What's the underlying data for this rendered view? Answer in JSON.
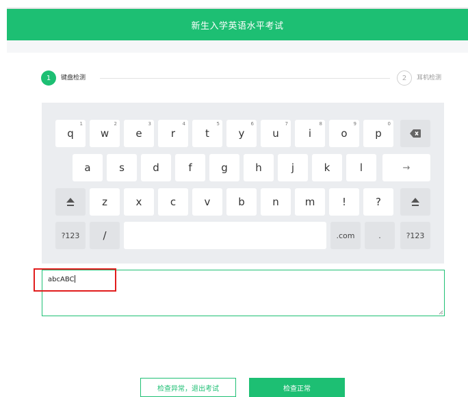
{
  "header": {
    "title": "新生入学英语水平考试"
  },
  "steps": [
    {
      "number": "1",
      "label": "键盘检测"
    },
    {
      "number": "2",
      "label": "耳机检测"
    }
  ],
  "keyboard": {
    "row1": [
      {
        "char": "q",
        "hint": "1"
      },
      {
        "char": "w",
        "hint": "2"
      },
      {
        "char": "e",
        "hint": "3"
      },
      {
        "char": "r",
        "hint": "4"
      },
      {
        "char": "t",
        "hint": "5"
      },
      {
        "char": "y",
        "hint": "6"
      },
      {
        "char": "u",
        "hint": "7"
      },
      {
        "char": "i",
        "hint": "8"
      },
      {
        "char": "o",
        "hint": "9"
      },
      {
        "char": "p",
        "hint": "0"
      }
    ],
    "row2": [
      "a",
      "s",
      "d",
      "f",
      "g",
      "h",
      "j",
      "k",
      "l"
    ],
    "enter_glyph": "→",
    "row3": [
      "z",
      "x",
      "c",
      "v",
      "b",
      "n",
      "m",
      "!",
      "?"
    ],
    "row4": {
      "numeric_left": "?123",
      "slash": "/",
      "dotcom": ".com",
      "period": ".",
      "numeric_right": "?123"
    }
  },
  "input": {
    "value": "abcABC"
  },
  "buttons": {
    "abnormal": "检查异常，退出考试",
    "normal": "检查正常"
  },
  "colors": {
    "accent": "#1dbf73",
    "highlight": "#e11b1b",
    "keyboard_bg": "#ebedf0"
  },
  "icons": [
    "backspace-icon",
    "shift-icon",
    "enter-arrow-icon",
    "resize-grip-icon"
  ]
}
